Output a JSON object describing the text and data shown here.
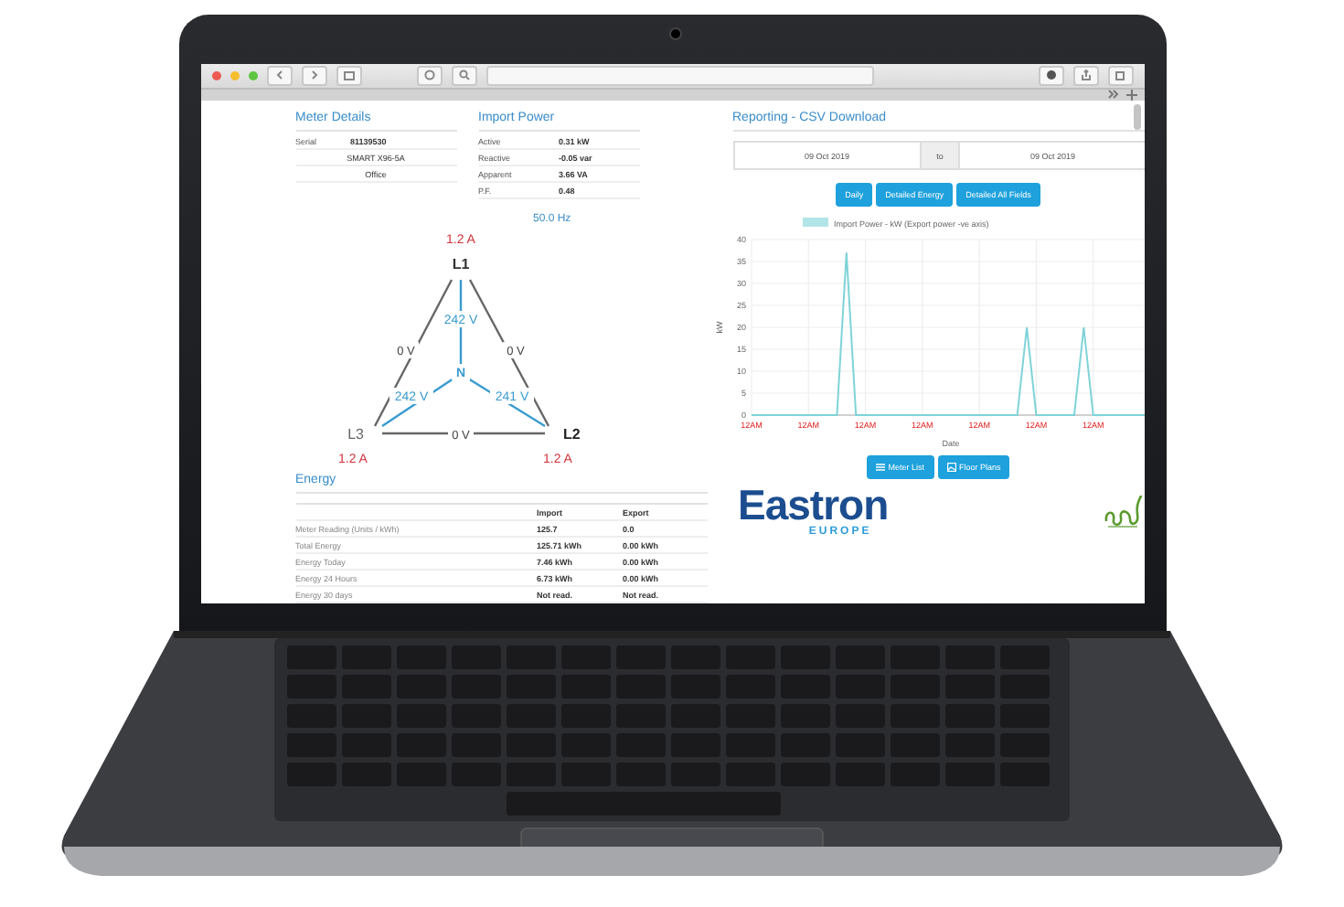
{
  "meter_details": {
    "title": "Meter Details",
    "rows": [
      {
        "label": "Serial",
        "value": "81139530"
      },
      {
        "value": "SMART X96-5A"
      },
      {
        "value": "Office"
      }
    ]
  },
  "import_power": {
    "title": "Import Power",
    "rows": [
      {
        "label": "Active",
        "value": "0.31 kW"
      },
      {
        "label": "Reactive",
        "value": "-0.05 var"
      },
      {
        "label": "Apparent",
        "value": "3.66 VA"
      },
      {
        "label": "P.F.",
        "value": "0.48"
      }
    ]
  },
  "frequency": "50.0 Hz",
  "phase_diagram": {
    "l1": {
      "label": "L1",
      "current": "1.2 A"
    },
    "l2": {
      "label": "L2",
      "current": "1.2 A"
    },
    "l3": {
      "label": "L3",
      "current": "1.2 A"
    },
    "neutral": "N",
    "l1_n": "242 V",
    "l3_n": "242 V",
    "l2_n": "241 V",
    "l1_l3": "0 V",
    "l1_l2": "0 V",
    "l3_l2": "0 V"
  },
  "energy": {
    "title": "Energy",
    "columns": [
      "Import",
      "Export"
    ],
    "rows": [
      {
        "label": "Meter Reading (Units / kWh)",
        "import": "125.7",
        "export": "0.0"
      },
      {
        "label": "Total Energy",
        "import": "125.71 kWh",
        "export": "0.00 kWh"
      },
      {
        "label": "Energy Today",
        "import": "7.46 kWh",
        "export": "0.00 kWh"
      },
      {
        "label": "Energy 24 Hours",
        "import": "6.73 kWh",
        "export": "0.00 kWh"
      },
      {
        "label": "Energy 30 days",
        "import": "Not read.",
        "export": "Not read."
      }
    ]
  },
  "reporting": {
    "title": "Reporting - CSV Download",
    "date_from": "09 Oct 2019",
    "to_label": "to",
    "date_to": "09 Oct 2019",
    "buttons": [
      "Daily",
      "Detailed Energy",
      "Detailed All Fields"
    ],
    "chart_data": {
      "type": "line",
      "xlabel": "Date",
      "ylabel": "kW",
      "categories": [
        "12AM",
        null,
        null,
        null,
        null,
        null,
        "12AM",
        null,
        null,
        null,
        null,
        null,
        "12AM",
        null,
        null,
        null,
        null,
        null,
        "12AM",
        null,
        null,
        null,
        null,
        null,
        "12AM",
        null,
        null,
        null,
        null,
        null,
        "12AM",
        null,
        null,
        null,
        null,
        null,
        "12AM",
        null,
        null,
        null,
        null,
        null,
        null
      ],
      "series": [
        {
          "name": "Import Power - kW (Export power -ve axis)",
          "color": "#7fd3d8",
          "values": [
            0,
            0,
            0,
            0,
            0,
            0,
            0,
            0,
            0,
            0,
            37,
            0,
            0,
            0,
            0,
            0,
            0,
            0,
            0,
            0,
            0,
            0,
            0,
            0,
            0,
            0,
            0,
            0,
            0,
            20,
            0,
            0,
            0,
            0,
            0,
            20,
            0,
            0,
            0,
            0,
            0,
            0,
            0
          ]
        }
      ],
      "grid": true,
      "ylim": [
        0,
        40
      ],
      "yticks": [
        0,
        5,
        10,
        15,
        20,
        25,
        30,
        35,
        40
      ]
    },
    "nav_buttons": [
      "Meter List",
      "Floor Plans"
    ]
  },
  "logo": {
    "name": "Eastron",
    "subtitle": "EUROPE"
  }
}
